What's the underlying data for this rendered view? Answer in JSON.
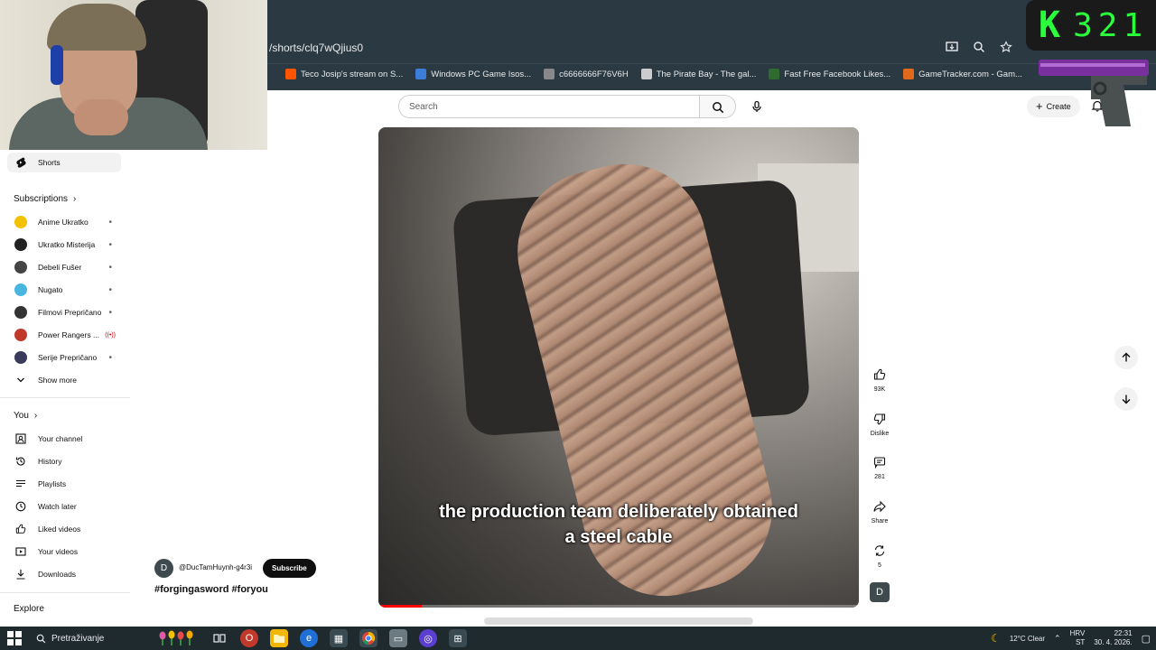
{
  "browser": {
    "url": "/shorts/clq7wQjius0",
    "bookmarks": [
      {
        "label": "Teco Josip's stream on S...",
        "color": "#ff5500"
      },
      {
        "label": "Windows PC Game Isos...",
        "color": "#3c7dd9"
      },
      {
        "label": "c6666666F76V6H",
        "color": "#888888"
      },
      {
        "label": "The Pirate Bay - The gal...",
        "color": "#cccccc"
      },
      {
        "label": "Fast Free Facebook Likes...",
        "color": "#2f6b2f"
      },
      {
        "label": "GameTracker.com - Gam...",
        "color": "#e06a1a"
      }
    ]
  },
  "overlay": {
    "score_letter": "K",
    "score_value": "321"
  },
  "header": {
    "search_placeholder": "Search",
    "create_label": "Create"
  },
  "sidebar": {
    "shorts_label": "Shorts",
    "subscriptions_header": "Subscriptions",
    "subscriptions": [
      {
        "label": "Anime Ukratko",
        "color": "#f2c200"
      },
      {
        "label": "Ukratko Misterija",
        "color": "#222222"
      },
      {
        "label": "Debeli Fušer",
        "color": "#444444"
      },
      {
        "label": "Nugato",
        "color": "#49b6e0"
      },
      {
        "label": "Filmovi Prepričano",
        "color": "#333333"
      },
      {
        "label": "Power Rangers ...",
        "color": "#c0392b",
        "live": "((•))"
      },
      {
        "label": "Serije Prepričano",
        "color": "#3a3a5a"
      }
    ],
    "show_more_label": "Show more",
    "you_header": "You",
    "you_items": [
      {
        "label": "Your channel",
        "icon": "channel-icon"
      },
      {
        "label": "History",
        "icon": "history-icon"
      },
      {
        "label": "Playlists",
        "icon": "playlist-icon"
      },
      {
        "label": "Watch later",
        "icon": "clock-icon"
      },
      {
        "label": "Liked videos",
        "icon": "thumb-up-icon"
      },
      {
        "label": "Your videos",
        "icon": "video-icon"
      },
      {
        "label": "Downloads",
        "icon": "download-icon"
      }
    ],
    "explore_header": "Explore"
  },
  "video": {
    "caption_line1": "the production team deliberately obtained",
    "caption_line2": "a steel cable",
    "progress": 0.09,
    "channel_initial": "D",
    "channel_name": "@DucTamHuynh-g4r3i",
    "subscribe_label": "Subscribe",
    "title": "#forgingasword #foryou"
  },
  "actions": {
    "likes": "93K",
    "dislike_label": "Dislike",
    "comments": "281",
    "share_label": "Share",
    "remix_count": "5",
    "channel_initial": "D"
  },
  "taskbar": {
    "search_text": "Pretraživanje",
    "weather": "12°C  Clear",
    "lang": "HRV",
    "lang_sub": "ST",
    "time": "22:31",
    "date": "30. 4. 2026."
  }
}
